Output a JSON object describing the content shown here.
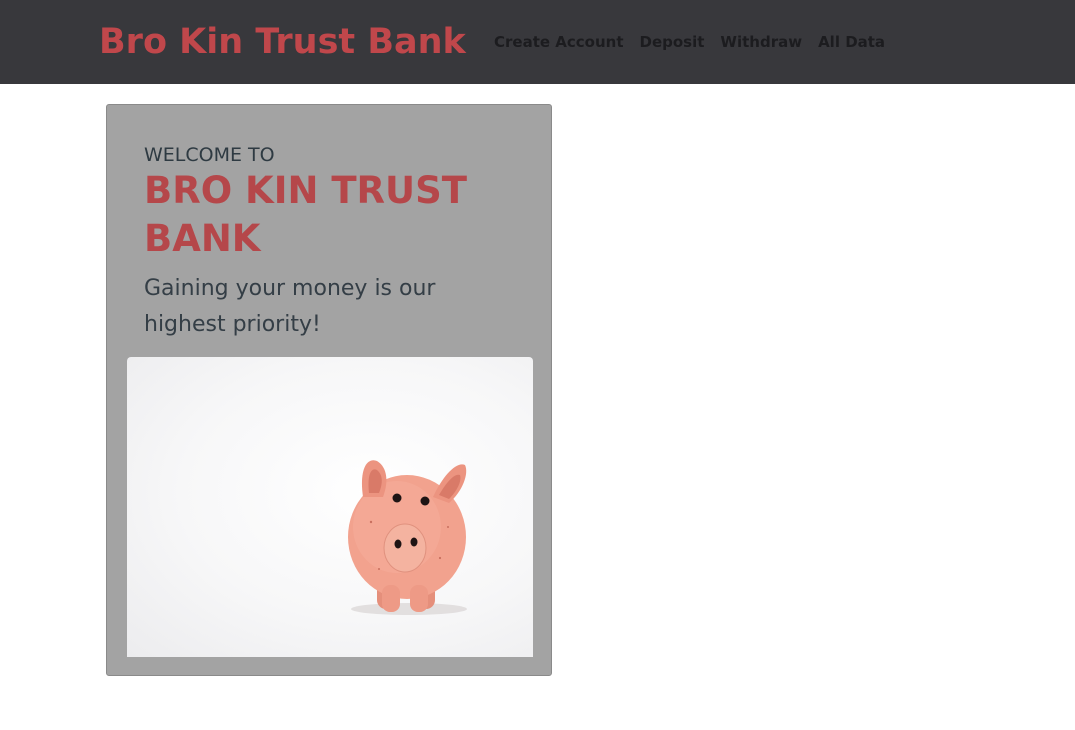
{
  "navbar": {
    "brand": "Bro Kin Trust Bank",
    "links": [
      {
        "label": "Create Account"
      },
      {
        "label": "Deposit"
      },
      {
        "label": "Withdraw"
      },
      {
        "label": "All Data"
      }
    ]
  },
  "hero": {
    "welcome": "WELCOME TO",
    "title": "BRO KIN TRUST BANK",
    "tagline": "Gaining your money is our highest priority!",
    "image_icon": "piggy-bank-photo"
  },
  "colors": {
    "navbar_bg": "#38383c",
    "brand": "#c0474b",
    "card_bg": "#a3a3a3",
    "title": "#b5474a"
  }
}
